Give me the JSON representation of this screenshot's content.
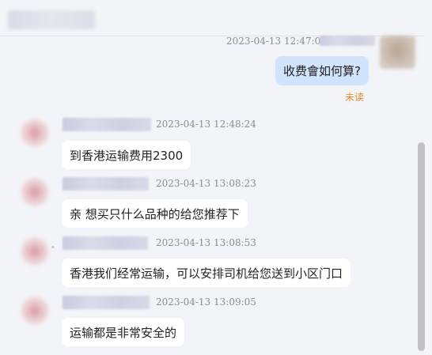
{
  "header": {
    "title_blurred": true
  },
  "self_message": {
    "timestamp": "2023-04-13 12:47:09",
    "text": "收费會如何算?",
    "status": "未读"
  },
  "messages": [
    {
      "timestamp": "2023-04-13 12:48:24",
      "text": "到香港运输费用2300"
    },
    {
      "timestamp": "2023-04-13 13:08:23",
      "text": "亲 想买只什么品种的给您推荐下"
    },
    {
      "timestamp": "2023-04-13 13:08:53",
      "text": "香港我们经常运输，可以安排司机给您送到小区门口"
    },
    {
      "timestamp": "2023-04-13 13:09:05",
      "text": "运输都是非常安全的"
    }
  ],
  "colors": {
    "background": "#f3f4f7",
    "incoming_bubble": "#ffffff",
    "outgoing_bubble": "#d2e3fc",
    "unread_status": "#e3872e",
    "timestamp": "#8a8d96"
  }
}
